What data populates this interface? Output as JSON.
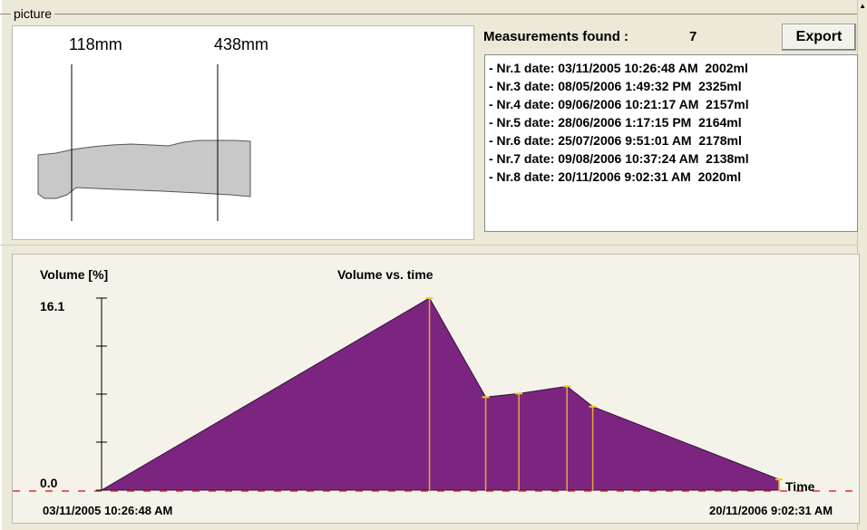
{
  "window": {
    "group_title": "picture"
  },
  "picture": {
    "label_left": "118mm",
    "label_right": "438mm"
  },
  "measurements": {
    "label": "Measurements found :",
    "count": "7",
    "export_label": "Export",
    "items": [
      "- Nr.1 date: 03/11/2005 10:26:48 AM  2002ml",
      "- Nr.3 date: 08/05/2006 1:49:32 PM  2325ml",
      "- Nr.4 date: 09/06/2006 10:21:17 AM  2157ml",
      "- Nr.5 date: 28/06/2006 1:17:15 PM  2164ml",
      "- Nr.6 date: 25/07/2006 9:51:01 AM  2178ml",
      "- Nr.7 date: 09/08/2006 10:37:24 AM  2138ml",
      "- Nr.8 date: 20/11/2006 9:02:31 AM  2020ml"
    ]
  },
  "colors": {
    "fill": "#7b2580",
    "stem": "#e8a838",
    "baseline": "#e03030"
  },
  "chart_data": {
    "type": "area",
    "title": "Volume vs. time",
    "ylabel": "Volume [%]",
    "xlabel": "Time",
    "ylim": [
      0.0,
      16.1
    ],
    "ytick_top": "16.1",
    "ytick_bottom": "0.0",
    "x_start_label": "03/11/2005 10:26:48 AM",
    "x_end_label": "20/11/2006 9:02:31 AM",
    "x": [
      "03/11/2005 10:26:48 AM",
      "08/05/2006 1:49:32 PM",
      "09/06/2006 10:21:17 AM",
      "28/06/2006 1:17:15 PM",
      "25/07/2006 9:51:01 AM",
      "09/08/2006 10:37:24 AM",
      "20/11/2006 9:02:31 AM"
    ],
    "x_frac": [
      0.0,
      0.484,
      0.567,
      0.616,
      0.687,
      0.725,
      1.0
    ],
    "values": [
      0.0,
      16.1,
      7.8,
      8.1,
      8.7,
      7.0,
      0.9
    ]
  }
}
